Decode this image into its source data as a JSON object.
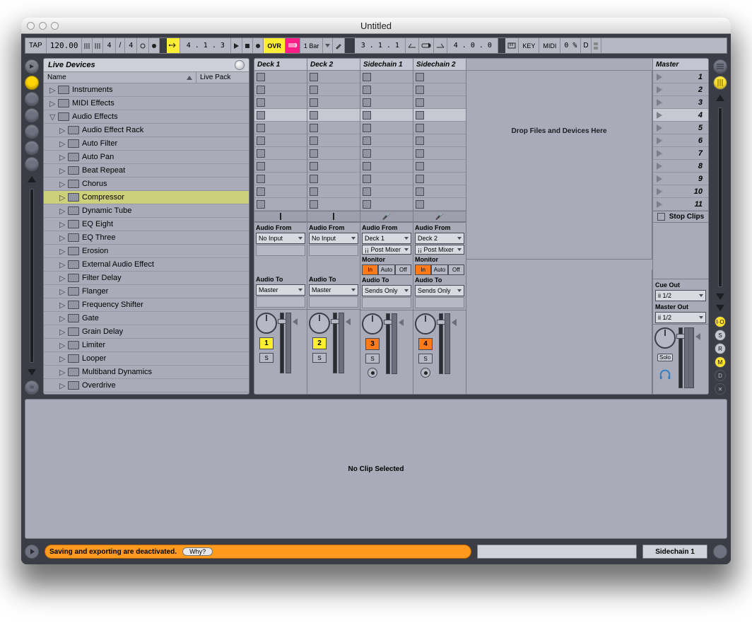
{
  "window": {
    "title": "Untitled"
  },
  "controlbar": {
    "tap": "TAP",
    "tempo": "120.00",
    "timesig_a": "4",
    "timesig_b": "4",
    "metronome": "●",
    "playquant_arrow": "↦",
    "bar_pos": "4 .  1 .  3",
    "ovr": "OVR",
    "bars": "1 Bar",
    "loop_pos": "3 .  1 .  1",
    "loop_len": "4 .  0 .  0",
    "key": "KEY",
    "midi": "MIDI",
    "cpu": "0 %",
    "d": "D"
  },
  "browser": {
    "title": "Live Devices",
    "cols": {
      "name": "Name",
      "pack": "Live Pack"
    },
    "tree": [
      {
        "indent": 0,
        "label": "Instruments",
        "open": false
      },
      {
        "indent": 0,
        "label": "MIDI Effects",
        "open": false
      },
      {
        "indent": 0,
        "label": "Audio Effects",
        "open": true
      },
      {
        "indent": 1,
        "label": "Audio Effect Rack"
      },
      {
        "indent": 1,
        "label": "Auto Filter"
      },
      {
        "indent": 1,
        "label": "Auto Pan"
      },
      {
        "indent": 1,
        "label": "Beat Repeat"
      },
      {
        "indent": 1,
        "label": "Chorus"
      },
      {
        "indent": 1,
        "label": "Compressor",
        "selected": true
      },
      {
        "indent": 1,
        "label": "Dynamic Tube"
      },
      {
        "indent": 1,
        "label": "EQ Eight"
      },
      {
        "indent": 1,
        "label": "EQ Three"
      },
      {
        "indent": 1,
        "label": "Erosion"
      },
      {
        "indent": 1,
        "label": "External Audio Effect"
      },
      {
        "indent": 1,
        "label": "Filter Delay"
      },
      {
        "indent": 1,
        "label": "Flanger"
      },
      {
        "indent": 1,
        "label": "Frequency Shifter"
      },
      {
        "indent": 1,
        "label": "Gate"
      },
      {
        "indent": 1,
        "label": "Grain Delay"
      },
      {
        "indent": 1,
        "label": "Limiter"
      },
      {
        "indent": 1,
        "label": "Looper"
      },
      {
        "indent": 1,
        "label": "Multiband Dynamics"
      },
      {
        "indent": 1,
        "label": "Overdrive"
      }
    ]
  },
  "session": {
    "tracks": [
      {
        "name": "Deck 1",
        "audio_from": "No Input",
        "audio_to": "Master",
        "num": "1",
        "numclass": "y",
        "rec": false
      },
      {
        "name": "Deck 2",
        "audio_from": "No Input",
        "audio_to": "Master",
        "num": "2",
        "numclass": "y",
        "rec": false
      },
      {
        "name": "Sidechain 1",
        "audio_from": "Deck 1",
        "chain": "¡¡ Post Mixer",
        "monitor": "In",
        "audio_to": "Sends Only",
        "num": "3",
        "numclass": "o",
        "rec": true
      },
      {
        "name": "Sidechain 2",
        "audio_from": "Deck 2",
        "chain": "¡¡ Post Mixer",
        "monitor": "In",
        "audio_to": "Sends Only",
        "num": "4",
        "numclass": "o",
        "rec": true
      }
    ],
    "drop_hint": "Drop Files and Devices Here",
    "master": {
      "name": "Master",
      "scenes": [
        "1",
        "2",
        "3",
        "4",
        "5",
        "6",
        "7",
        "8",
        "9",
        "10",
        "11"
      ],
      "stop": "Stop Clips",
      "cue_label": "Cue Out",
      "cue_val": "ii 1/2",
      "master_label": "Master Out",
      "master_val": "ii 1/2",
      "solo": "Solo"
    },
    "io_labels": {
      "audio_from": "Audio From",
      "monitor": "Monitor",
      "audio_to": "Audio To",
      "in": "In",
      "auto": "Auto",
      "off": "Off",
      "s": "S"
    }
  },
  "detail": {
    "msg": "No Clip Selected"
  },
  "status": {
    "msg": "Saving and exporting are deactivated.",
    "why": "Why?",
    "track": "Sidechain 1"
  }
}
